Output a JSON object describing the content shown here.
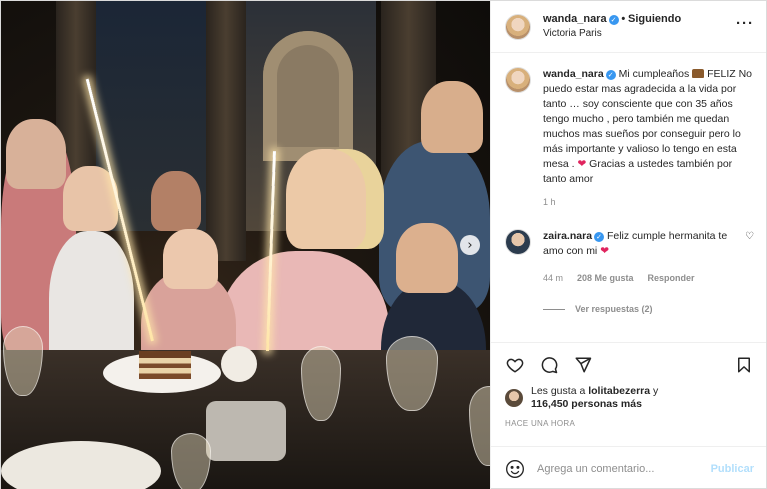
{
  "post": {
    "author": {
      "username": "wanda_nara",
      "follow_status": "Siguiendo",
      "follow_separator": "•",
      "location": "Victoria Paris"
    },
    "caption": {
      "username": "wanda_nara",
      "text_part1": "Mi cumpleaños",
      "text_part2": "FELIZ No puedo estar mas agradecida a la vida por tanto … soy consciente que con 35 años tengo mucho , pero también me quedan muchos mas sueños por conseguir pero lo más importante y valioso lo tengo en esta mesa .",
      "text_part3": "Gracias a ustedes también por tanto amor",
      "time": "1 h"
    },
    "reply": {
      "username": "zaira.nara",
      "text": "Feliz cumple hermanita te amo con mi",
      "time": "44 m",
      "likes": "208 Me gusta",
      "reply_label": "Responder",
      "view_replies": "Ver respuestas (2)"
    },
    "likes": {
      "prefix": "Les gusta a",
      "user": "lolitabezerra",
      "connector": "y",
      "count": "116,450 personas más"
    },
    "time_ago": "HACE UNA HORA",
    "comment_input": {
      "placeholder": "Agrega un comentario...",
      "publish_label": "Publicar"
    },
    "icons": {
      "more": "more-options-icon",
      "next": "chevron-right-icon",
      "like": "heart-icon",
      "comment": "comment-icon",
      "share": "share-icon",
      "save": "bookmark-icon",
      "emoji": "emoji-icon"
    },
    "colors": {
      "verified": "#3897f0",
      "heart": "#e0245e",
      "publish": "#b2dffc",
      "muted": "#8e8e8e"
    }
  }
}
